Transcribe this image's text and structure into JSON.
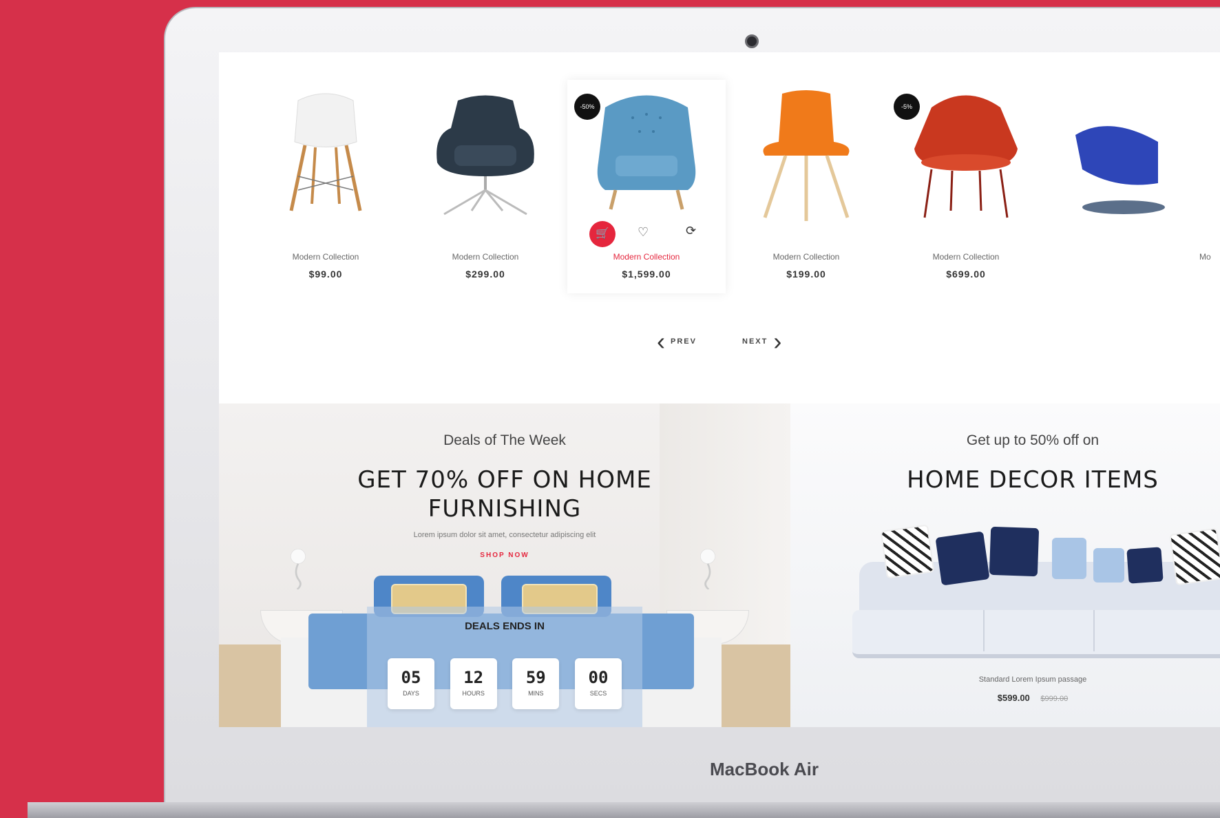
{
  "device": {
    "brand_label": "MacBook Air"
  },
  "products": [
    {
      "name": "Modern Collection",
      "price": "$99.00",
      "badge": "",
      "featured": false
    },
    {
      "name": "Modern Collection",
      "price": "$299.00",
      "badge": "",
      "featured": false
    },
    {
      "name": "Modern Collection",
      "price": "$1,599.00",
      "badge": "-50%",
      "featured": true
    },
    {
      "name": "Modern Collection",
      "price": "$199.00",
      "badge": "",
      "featured": false
    },
    {
      "name": "Modern Collection",
      "price": "$699.00",
      "badge": "-5%",
      "featured": false
    },
    {
      "name": "Mo",
      "price": "",
      "badge": "",
      "featured": false
    }
  ],
  "pager": {
    "prev_label": "PREV",
    "next_label": "NEXT"
  },
  "deals": {
    "subtitle": "Deals of The Week",
    "headline_line1": "GET 70% OFF ON HOME",
    "headline_line2": "FURNISHING",
    "description": "Lorem ipsum dolor sit amet, consectetur adipiscing elit",
    "cta": "SHOP NOW",
    "timer_title": "DEALS ENDS IN",
    "timer": [
      {
        "value": "05",
        "unit": "DAYS"
      },
      {
        "value": "12",
        "unit": "HOURS"
      },
      {
        "value": "59",
        "unit": "MINS"
      },
      {
        "value": "00",
        "unit": "SECS"
      }
    ]
  },
  "decor": {
    "subtitle": "Get up to 50% off on",
    "headline": "HOME DECOR ITEMS",
    "caption": "Standard Lorem Ipsum passage",
    "price_now": "$599.00",
    "price_old": "$999.00"
  },
  "colors": {
    "accent": "#e5263d",
    "background": "#d6304a"
  },
  "icons": {
    "cart": "cart-icon",
    "wishlist": "heart-icon",
    "compare": "refresh-icon"
  }
}
